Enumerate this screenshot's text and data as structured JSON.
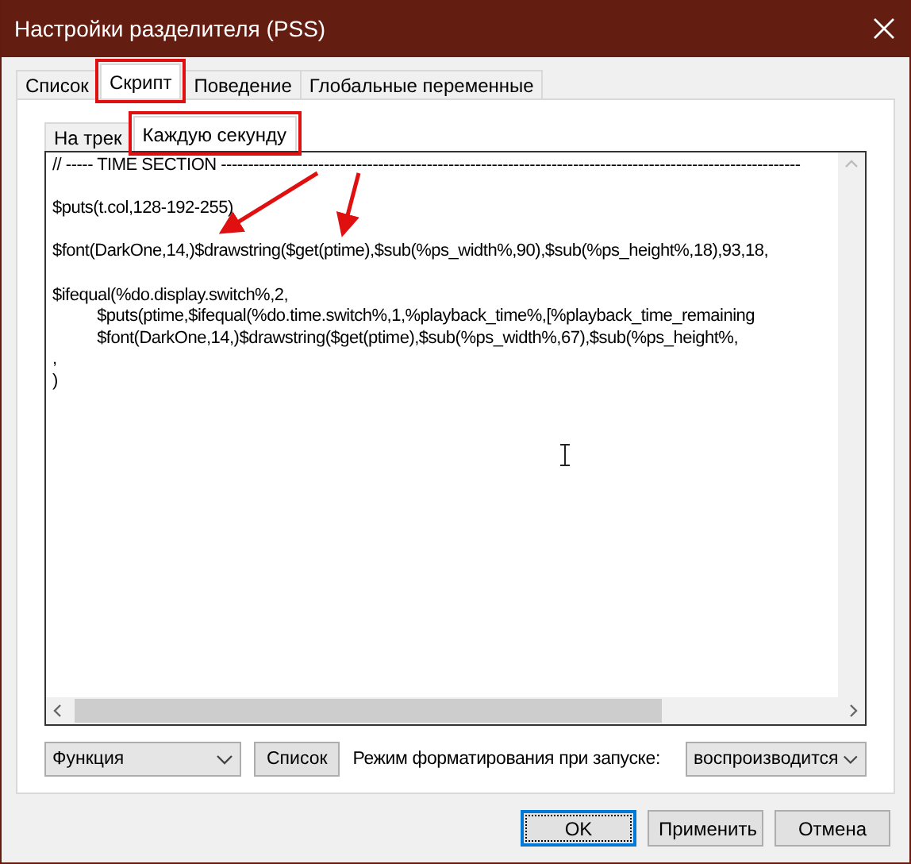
{
  "window": {
    "title": "Настройки разделителя (PSS)"
  },
  "tabs": [
    {
      "label": "Список",
      "selected": false,
      "highlighted": false
    },
    {
      "label": "Скрипт",
      "selected": true,
      "highlighted": true
    },
    {
      "label": "Поведение",
      "selected": false,
      "highlighted": false
    },
    {
      "label": "Глобальные переменные",
      "selected": false,
      "highlighted": false
    }
  ],
  "subtabs": [
    {
      "label": "На трек",
      "selected": false,
      "highlighted": false
    },
    {
      "label": "Каждую секунду",
      "selected": true,
      "highlighted": true
    }
  ],
  "editor": {
    "paragraphs": [
      [
        "// ----- TIME SECTION -----------------------------------------------------------------------------------------------------------"
      ],
      [
        "$puts(t.col,128-192-255)"
      ],
      [
        "$font(DarkOne,14,)$drawstring($get(ptime),$sub(%ps_width%,90),$sub(%ps_height%,18),93,18,"
      ],
      [
        "$ifequal(%do.display.switch%,2,",
        "\t$puts(ptime,$ifequal(%do.time.switch%,1,%playback_time%,[%playback_time_remaining",
        "\t$font(DarkOne,14,)$drawstring($get(ptime),$sub(%ps_width%,67),$sub(%ps_height%,",
        ",",
        ")"
      ]
    ]
  },
  "bottom": {
    "function_select": "Функция",
    "list_button": "Список",
    "mode_label": "Режим форматирования при запуске:",
    "mode_select": "воспроизводится"
  },
  "buttons": [
    {
      "label": "OK",
      "default": true
    },
    {
      "label": "Применить",
      "default": false
    },
    {
      "label": "Отмена",
      "default": false
    }
  ]
}
